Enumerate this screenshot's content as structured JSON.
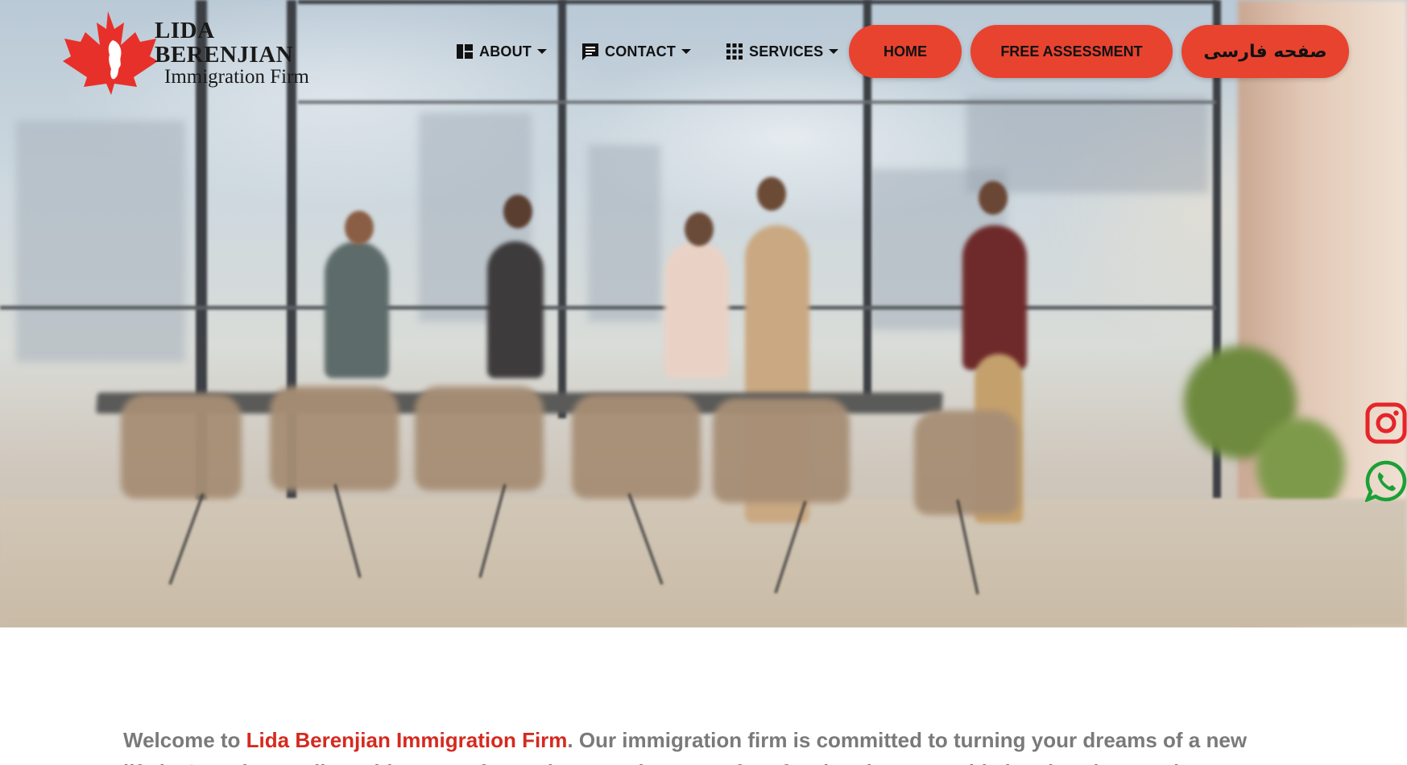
{
  "logo": {
    "title_line1": "LIDA BERENJIAN",
    "title_line2": "Immigration Firm",
    "leaf_color": "#e8302a"
  },
  "nav": {
    "about": "ABOUT",
    "contact": "CONTACT",
    "services": "SERVICES"
  },
  "buttons": {
    "home": "HOME",
    "free_assessment": "FREE ASSESSMENT",
    "farsi_page": "صفحه فارسی"
  },
  "social": {
    "instagram_icon": "instagram-icon",
    "whatsapp_icon": "whatsapp-icon",
    "instagram_color": "#e5242b",
    "whatsapp_color": "#1aa037"
  },
  "welcome": {
    "prefix": "Welcome to ",
    "brand": "Lida Berenjian Immigration Firm",
    "suffix": ". Our immigration firm is committed to turning your dreams of a new",
    "line2": "life in Canada a reality. With years of experience and a team of professionals we provide immigration services"
  },
  "colors": {
    "accent": "#e8432f",
    "brand_text": "#d52a1f",
    "body_text": "#7a7a7a"
  }
}
